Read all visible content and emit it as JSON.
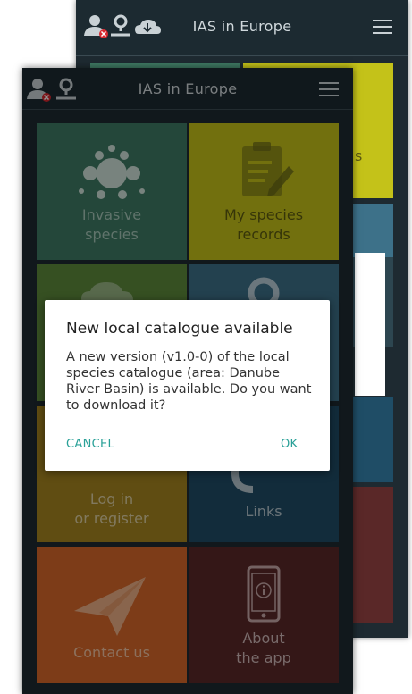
{
  "app_title": "IAS in Europe",
  "stray_letter": "C",
  "tiles": {
    "invasive_species": "Invasive\nspecies",
    "my_species_records": "My species\nrecords",
    "log_in": "Log in\nor register",
    "links": "Links",
    "contact_us": "Contact us",
    "about": "About\nthe app"
  },
  "back_partial_text": "s",
  "dialog": {
    "title": "New local catalogue available",
    "message": "A new version (v1.0-0) of the local species catalogue (area: Danube River Basin) is available. Do you want to download it?",
    "cancel_label": "CANCEL",
    "ok_label": "OK"
  },
  "colors": {
    "invasive_species": "#3f7a64",
    "my_species_records": "#c4c219",
    "green_tile": "#5e8a3c",
    "blue_tile": "#3d7189",
    "log_in": "#a6861f",
    "links": "#1f4d66",
    "contact_us": "#d7682a",
    "about": "#5a2828",
    "accent": "#2aa198"
  }
}
